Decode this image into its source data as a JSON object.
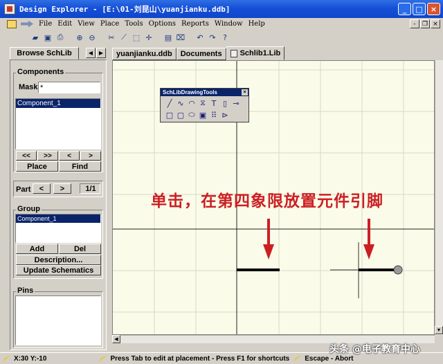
{
  "window": {
    "title": "Design Explorer  - [E:\\01-刘昆山\\yuanjianku.ddb]",
    "min_glyph": "_",
    "max_glyph": "□",
    "close_glyph": "×"
  },
  "menubar": {
    "items": [
      "File",
      "Edit",
      "View",
      "Place",
      "Tools",
      "Options",
      "Reports",
      "Window",
      "Help"
    ],
    "mdi_min": "-",
    "mdi_restore": "❐",
    "mdi_close": "×"
  },
  "toolbar": {
    "icons": [
      "folder-open-icon",
      "save-icon",
      "print-icon",
      "zoom-in-icon",
      "zoom-out-icon",
      "cut-icon",
      "wire-icon",
      "select-icon",
      "move-icon",
      "reports-icon",
      "clear-icon",
      "undo-icon",
      "redo-icon",
      "help-icon"
    ]
  },
  "left_panel": {
    "tab_label": "Browse SchLib",
    "tab_prev": "◀",
    "tab_next": "▶",
    "components_label": "Components",
    "mask_label": "Mask",
    "mask_value": "*",
    "component_list": [
      "Component_1"
    ],
    "nav_first": "<<",
    "nav_last": ">>",
    "nav_prev": "<",
    "nav_next": ">",
    "place_label": "Place",
    "find_label": "Find",
    "part_label": "Part",
    "part_prev": "<",
    "part_next": ">",
    "part_value": "1/1",
    "group_label": "Group",
    "group_list": [
      "Component_1"
    ],
    "add_label": "Add",
    "del_label": "Del",
    "description_label": "Description...",
    "update_label": "Update Schematics",
    "pins_label": "Pins"
  },
  "doc_tabs": [
    "yuanjianku.ddb",
    "Documents",
    "Schlib1.Lib"
  ],
  "drawing_toolbox": {
    "title": "SchLibDrawingTools",
    "close_glyph": "×",
    "row1": [
      "line-icon",
      "bezier-icon",
      "arc-icon",
      "polygon-icon",
      "text-icon",
      "new-part-icon",
      "pin-icon"
    ],
    "row2": [
      "rectangle-icon",
      "rounded-rectangle-icon",
      "ellipse-icon",
      "image-icon",
      "array-icon",
      "ieee-symbol-icon"
    ]
  },
  "annotation": "单击，在第四象限放置元件引脚",
  "status": {
    "coords": "X:30 Y:-10",
    "message": "Press Tab to edit at placement - Press F1 for shortcuts",
    "escape": "Escape - Abort"
  },
  "watermark": "头条 @电子教育中心",
  "colors": {
    "annotation": "#cc1f24",
    "canvas": "#fafbe8",
    "grid": "#d8d8c8",
    "selection": "#0a246a"
  }
}
